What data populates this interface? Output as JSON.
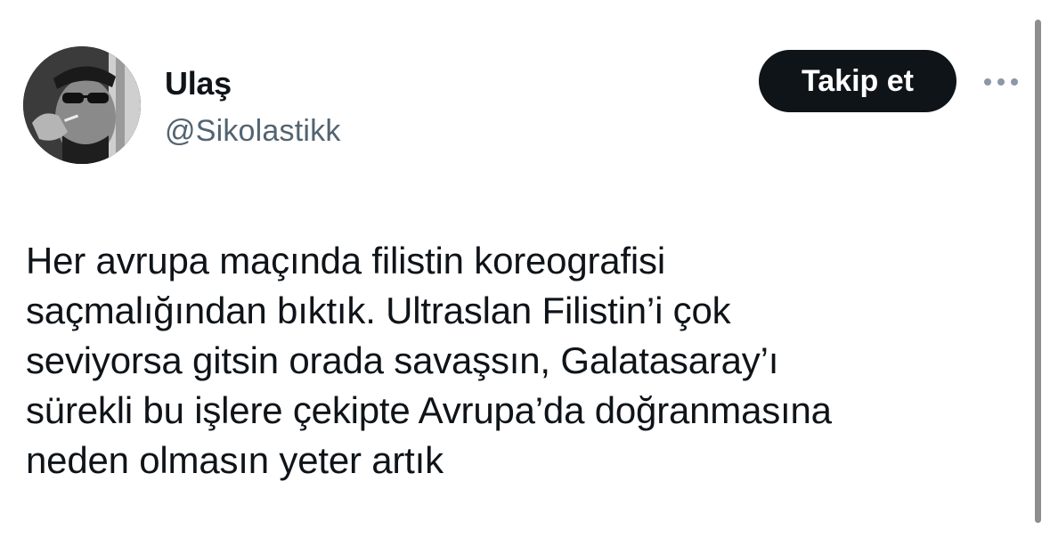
{
  "author": {
    "display_name": "Ulaş",
    "handle": "@Sikolastikk"
  },
  "actions": {
    "follow_label": "Takip et",
    "more_icon": "more-horizontal-icon"
  },
  "tweet": {
    "lines": [
      "Her avrupa maçında filistin koreografisi",
      "saçmalığından bıktık. Ultraslan Filistin’i çok",
      "seviyorsa gitsin orada savaşsın, Galatasaray’ı",
      "sürekli bu işlere çekipte Avrupa’da doğranmasına",
      "neden olmasın yeter artık"
    ]
  },
  "colors": {
    "text_primary": "#0f1419",
    "text_secondary": "#536471",
    "button_bg": "#0f1419",
    "button_text": "#ffffff",
    "background": "#ffffff"
  }
}
